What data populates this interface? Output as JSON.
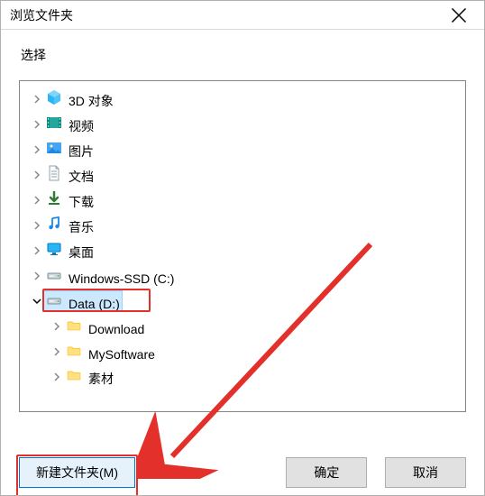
{
  "window": {
    "title": "浏览文件夹",
    "close_tooltip": "Close"
  },
  "prompt": "选择",
  "tree": {
    "items": [
      {
        "label": "3D 对象",
        "icon": "objects-3d",
        "depth": 0,
        "expanded": false
      },
      {
        "label": "视频",
        "icon": "videos",
        "depth": 0,
        "expanded": false
      },
      {
        "label": "图片",
        "icon": "pictures",
        "depth": 0,
        "expanded": false
      },
      {
        "label": "文档",
        "icon": "documents",
        "depth": 0,
        "expanded": false
      },
      {
        "label": "下载",
        "icon": "downloads",
        "depth": 0,
        "expanded": false
      },
      {
        "label": "音乐",
        "icon": "music",
        "depth": 0,
        "expanded": false
      },
      {
        "label": "桌面",
        "icon": "desktop",
        "depth": 0,
        "expanded": false
      },
      {
        "label": "Windows-SSD (C:)",
        "icon": "drive",
        "depth": 0,
        "expanded": false
      },
      {
        "label": "Data (D:)",
        "icon": "drive",
        "depth": 0,
        "expanded": true,
        "selected": true
      },
      {
        "label": "Download",
        "icon": "folder",
        "depth": 1,
        "expanded": false
      },
      {
        "label": "MySoftware",
        "icon": "folder",
        "depth": 1,
        "expanded": false
      },
      {
        "label": "素材",
        "icon": "folder",
        "depth": 1,
        "expanded": false
      }
    ]
  },
  "buttons": {
    "new_folder": "新建文件夹(M)",
    "ok": "确定",
    "cancel": "取消"
  },
  "annotations": {
    "highlight_tree_item": "Data (D:)",
    "highlight_button": "new_folder",
    "arrow": true
  }
}
